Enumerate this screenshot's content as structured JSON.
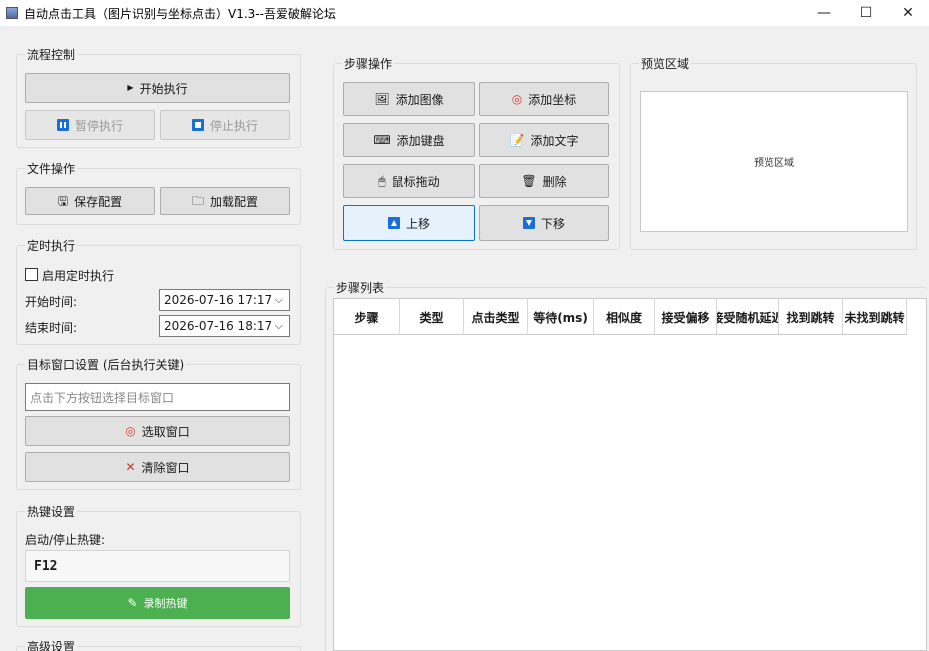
{
  "window": {
    "title": "自动点击工具（图片识别与坐标点击）V1.3--吾爱破解论坛",
    "minimize": "—",
    "maximize": "☐",
    "close": "✕"
  },
  "flow": {
    "title": "流程控制",
    "start": "开始执行",
    "pause": "暂停执行",
    "stop": "停止执行"
  },
  "file": {
    "title": "文件操作",
    "save": "保存配置",
    "load": "加载配置"
  },
  "timer": {
    "title": "定时执行",
    "enable": "启用定时执行",
    "enabled": false,
    "start_label": "开始时间:",
    "start_value": "2026-07-16 17:17",
    "end_label": "结束时间:",
    "end_value": "2026-07-16 18:17"
  },
  "target": {
    "title": "目标窗口设置 (后台执行关键)",
    "placeholder": "点击下方按钮选择目标窗口",
    "select": "选取窗口",
    "clear": "清除窗口"
  },
  "hotkey": {
    "title": "热键设置",
    "label": "启动/停止热键:",
    "value": "F12",
    "record": "录制热键"
  },
  "advanced": {
    "title": "高级设置"
  },
  "steps_ops": {
    "title": "步骤操作",
    "add_image": "添加图像",
    "add_coord": "添加坐标",
    "add_keyboard": "添加键盘",
    "add_text": "添加文字",
    "mouse_drag": "鼠标拖动",
    "delete": "删除",
    "move_up": "上移",
    "move_down": "下移"
  },
  "preview": {
    "title": "预览区域",
    "text": "预览区域"
  },
  "step_list": {
    "title": "步骤列表",
    "columns": [
      "步骤",
      "类型",
      "点击类型",
      "等待(ms)",
      "相似度",
      "接受偏移",
      "接受随机延迟",
      "找到跳转",
      "未找到跳转"
    ]
  },
  "colors": {
    "accent_blue": "#1a6fd6",
    "green": "#4caf50",
    "target_red": "#e53935",
    "clear_red": "#d32f2f"
  }
}
